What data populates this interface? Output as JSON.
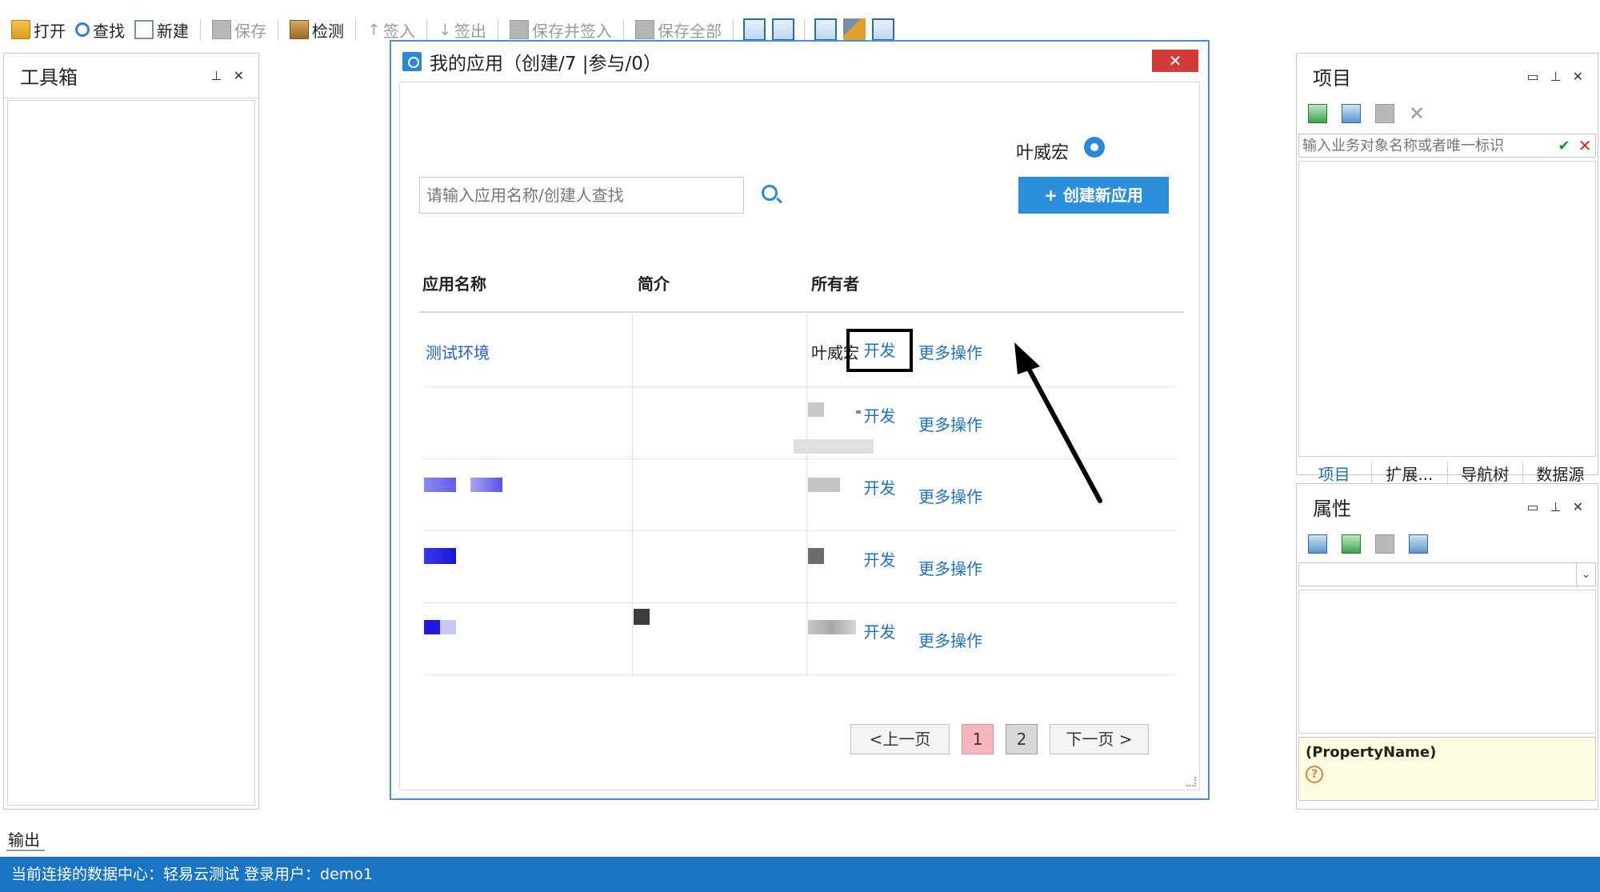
{
  "toolbar": {
    "open": "打开",
    "find": "查找",
    "new": "新建",
    "save": "保存",
    "check": "检测",
    "checkin": "签入",
    "checkout": "签出",
    "save_and_checkin": "保存并签入",
    "save_all": "保存全部"
  },
  "toolbox": {
    "title": "工具箱"
  },
  "project_panel": {
    "title": "项目",
    "search_placeholder": "输入业务对象名称或者唯一标识",
    "tabs": [
      "项目",
      "扩展...",
      "导航树",
      "数据源"
    ]
  },
  "properties_panel": {
    "title": "属性",
    "property_name": "(PropertyName)"
  },
  "output": {
    "label": "输出"
  },
  "status_bar": {
    "text": "当前连接的数据中心：轻易云测试  登录用户：demo1"
  },
  "dialog": {
    "title": "我的应用（创建/7 |参与/0）",
    "close": "✕",
    "user": "叶威宏",
    "search_placeholder": "请输入应用名称/创建人查找",
    "create_button": "+ 创建新应用",
    "columns": {
      "name": "应用名称",
      "desc": "简介",
      "owner": "所有者"
    },
    "rows": [
      {
        "name": "测试环境",
        "owner": "叶威宏",
        "dev": "开发",
        "more": "更多操作"
      },
      {
        "name": "",
        "owner": "",
        "dev": "开发",
        "more": "更多操作"
      },
      {
        "name": "",
        "owner": "",
        "dev": "开发",
        "more": "更多操作"
      },
      {
        "name": "",
        "owner": "",
        "dev": "开发",
        "more": "更多操作"
      },
      {
        "name": "",
        "owner": "",
        "dev": "开发",
        "more": "更多操作"
      }
    ],
    "pager": {
      "prev": "<上一页",
      "page1": "1",
      "page2": "2",
      "next": "下一页 >"
    }
  },
  "colors": {
    "accent": "#2b8fdb",
    "status_bar": "#1a74c4",
    "close_button": "#d33a3a",
    "link": "#1f70c0"
  }
}
